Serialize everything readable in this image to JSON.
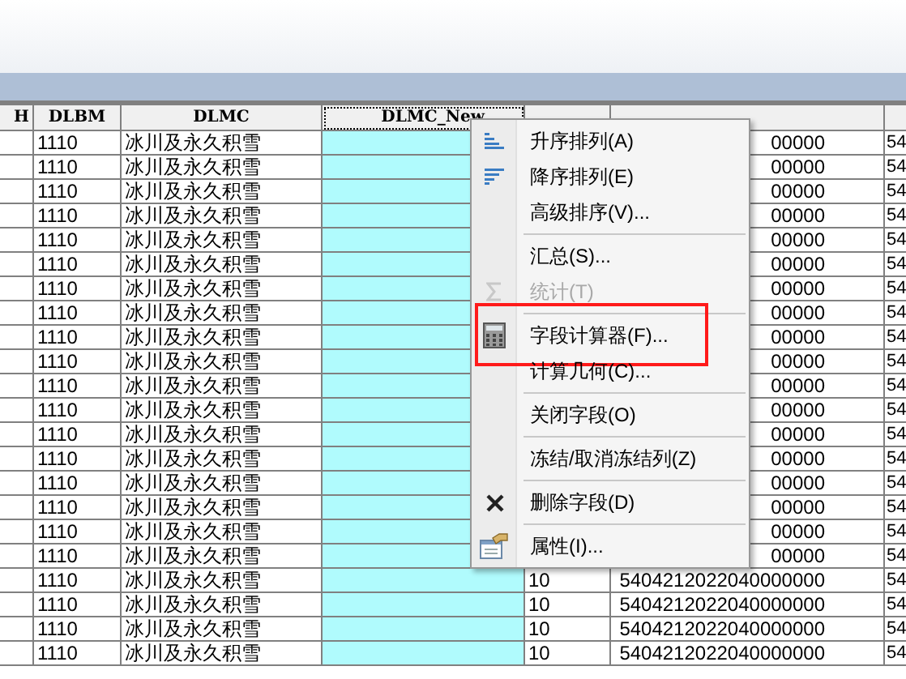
{
  "table": {
    "columns": [
      {
        "header": "H"
      },
      {
        "header": "DLBM"
      },
      {
        "header": "DLMC"
      },
      {
        "header": "DLMC_New",
        "selected": true
      },
      {},
      {},
      {}
    ],
    "rows": [
      {
        "dlbm": "1110",
        "dlmc": "冰川及永久积雪",
        "col5": "00000",
        "col6": "54"
      },
      {
        "dlbm": "1110",
        "dlmc": "冰川及永久积雪",
        "col5": "00000",
        "col6": "54"
      },
      {
        "dlbm": "1110",
        "dlmc": "冰川及永久积雪",
        "col5": "00000",
        "col6": "54"
      },
      {
        "dlbm": "1110",
        "dlmc": "冰川及永久积雪",
        "col5": "00000",
        "col6": "54"
      },
      {
        "dlbm": "1110",
        "dlmc": "冰川及永久积雪",
        "col5": "00000",
        "col6": "54"
      },
      {
        "dlbm": "1110",
        "dlmc": "冰川及永久积雪",
        "col5": "00000",
        "col6": "54"
      },
      {
        "dlbm": "1110",
        "dlmc": "冰川及永久积雪",
        "col5": "00000",
        "col6": "54"
      },
      {
        "dlbm": "1110",
        "dlmc": "冰川及永久积雪",
        "col5": "00000",
        "col6": "54"
      },
      {
        "dlbm": "1110",
        "dlmc": "冰川及永久积雪",
        "col5": "00000",
        "col6": "54"
      },
      {
        "dlbm": "1110",
        "dlmc": "冰川及永久积雪",
        "col5": "00000",
        "col6": "54"
      },
      {
        "dlbm": "1110",
        "dlmc": "冰川及永久积雪",
        "col5": "00000",
        "col6": "54"
      },
      {
        "dlbm": "1110",
        "dlmc": "冰川及永久积雪",
        "col5": "00000",
        "col6": "54"
      },
      {
        "dlbm": "1110",
        "dlmc": "冰川及永久积雪",
        "col5": "00000",
        "col6": "54"
      },
      {
        "dlbm": "1110",
        "dlmc": "冰川及永久积雪",
        "col5": "00000",
        "col6": "54"
      },
      {
        "dlbm": "1110",
        "dlmc": "冰川及永久积雪",
        "col5": "00000",
        "col6": "54"
      },
      {
        "dlbm": "1110",
        "dlmc": "冰川及永久积雪",
        "col5": "00000",
        "col6": "54"
      },
      {
        "dlbm": "1110",
        "dlmc": "冰川及永久积雪",
        "col5": "00000",
        "col6": "54"
      },
      {
        "dlbm": "1110",
        "dlmc": "冰川及永久积雪",
        "col5": "00000",
        "col6": "54"
      },
      {
        "dlbm": "1110",
        "dlmc": "冰川及永久积雪",
        "col4": "10",
        "col5": "5404212022040000000",
        "col6": "54"
      },
      {
        "dlbm": "1110",
        "dlmc": "冰川及永久积雪",
        "col4": "10",
        "col5": "5404212022040000000",
        "col6": "54"
      },
      {
        "dlbm": "1110",
        "dlmc": "冰川及永久积雪",
        "col4": "10",
        "col5": "5404212022040000000",
        "col6": "54"
      },
      {
        "dlbm": "1110",
        "dlmc": "冰川及永久积雪",
        "col4": "10",
        "col5": "5404212022040000000",
        "col6": "54"
      }
    ]
  },
  "context_menu": {
    "items": [
      {
        "kind": "item",
        "label": "升序排列(A)",
        "disabled": false
      },
      {
        "kind": "item",
        "label": "降序排列(E)",
        "disabled": false
      },
      {
        "kind": "item",
        "label": "高级排序(V)...",
        "disabled": false
      },
      {
        "kind": "separator"
      },
      {
        "kind": "item",
        "label": "汇总(S)...",
        "disabled": false
      },
      {
        "kind": "item",
        "label": "统计(T)",
        "disabled": true
      },
      {
        "kind": "separator"
      },
      {
        "kind": "item",
        "label": "字段计算器(F)...",
        "disabled": false,
        "highlighted": true
      },
      {
        "kind": "item",
        "label": "计算几何(C)...",
        "disabled": false
      },
      {
        "kind": "separator"
      },
      {
        "kind": "item",
        "label": "关闭字段(O)",
        "disabled": false
      },
      {
        "kind": "separator"
      },
      {
        "kind": "item",
        "label": "冻结/取消冻结列(Z)",
        "disabled": false
      },
      {
        "kind": "separator"
      },
      {
        "kind": "item",
        "label": "删除字段(D)",
        "disabled": false
      },
      {
        "kind": "separator"
      },
      {
        "kind": "item",
        "label": "属性(I)...",
        "disabled": false
      }
    ]
  }
}
